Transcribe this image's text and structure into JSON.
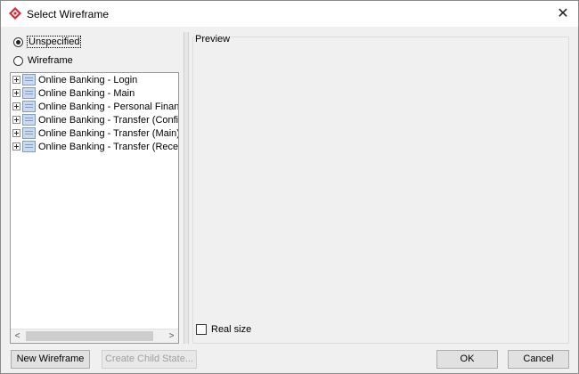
{
  "window": {
    "title": "Select Wireframe",
    "close_glyph": "✕"
  },
  "options": {
    "unspecified_label": "Unspecified",
    "wireframe_label": "Wireframe",
    "selected": "Unspecified"
  },
  "tree": {
    "items": [
      {
        "label": "Online Banking - Login"
      },
      {
        "label": "Online Banking - Main"
      },
      {
        "label": "Online Banking - Personal Finance"
      },
      {
        "label": "Online Banking - Transfer (Confirm)"
      },
      {
        "label": "Online Banking - Transfer (Main)"
      },
      {
        "label": "Online Banking - Transfer (Receipt)"
      }
    ],
    "scroll_left_glyph": "<",
    "scroll_right_glyph": ">"
  },
  "preview": {
    "label": "Preview",
    "real_size_label": "Real size",
    "real_size_checked": false
  },
  "buttons": {
    "new_wireframe": "New Wireframe",
    "create_child_state": "Create Child State...",
    "ok": "OK",
    "cancel": "Cancel"
  },
  "colors": {
    "accent": "#d9263a"
  }
}
